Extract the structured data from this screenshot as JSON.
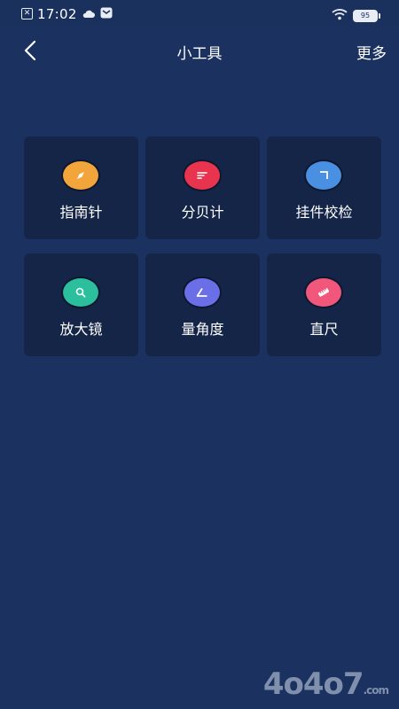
{
  "status_bar": {
    "time": "17:02",
    "battery": "95",
    "icons": [
      "notification-x-icon",
      "cloud-icon",
      "mail-icon",
      "wifi-icon",
      "battery-icon"
    ]
  },
  "header": {
    "back_icon": "chevron-left-icon",
    "title": "小工具",
    "more_label": "更多"
  },
  "tools": [
    {
      "label": "指南针",
      "icon": "compass-icon",
      "color": "#f2a53a"
    },
    {
      "label": "分贝计",
      "icon": "decibel-icon",
      "color": "#e8344e"
    },
    {
      "label": "挂件校检",
      "icon": "corner-icon",
      "color": "#4a90e2"
    },
    {
      "label": "放大镜",
      "icon": "magnifier-icon",
      "color": "#2bbf9e"
    },
    {
      "label": "量角度",
      "icon": "angle-icon",
      "color": "#6a6fe8"
    },
    {
      "label": "直尺",
      "icon": "ruler-icon",
      "color": "#f0577a"
    }
  ],
  "watermark": {
    "main": "4o4o7",
    "suffix": ".com"
  }
}
